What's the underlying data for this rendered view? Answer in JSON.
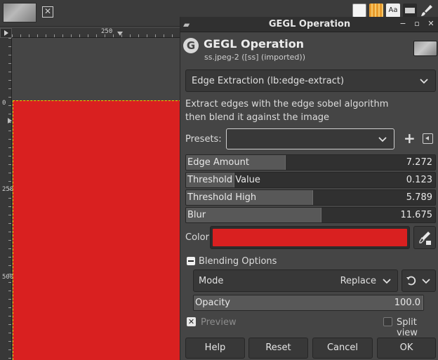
{
  "canvas": {
    "ruler_h_label": "250",
    "ruler_v_labels": [
      "0",
      "250",
      "500"
    ],
    "image_color": "#d92020",
    "selection_color": "#e6d400"
  },
  "toolbar": {
    "icons": [
      "new-layer-icon",
      "brushes-icon",
      "text-icon",
      "pattern-icon",
      "paintbrush-icon"
    ],
    "text_icon_label": "Aa"
  },
  "dialog": {
    "window_title": "GEGL Operation",
    "header_title": "GEGL Operation",
    "header_subtitle": "ss.jpeg-2 ([ss] (imported))",
    "operation": "Edge Extraction (lb:edge-extract)",
    "description_line1": "Extract edges with the edge sobel algorithm",
    "description_line2": "then blend it against the image",
    "presets_label": "Presets:",
    "presets_value": "",
    "sliders": [
      {
        "label": "Edge Amount",
        "value": "7.272",
        "fill": 0.4
      },
      {
        "label": "Threshold Value",
        "value": "0.123",
        "fill": 0.195
      },
      {
        "label": "Threshold High",
        "value": "5.789",
        "fill": 0.51
      },
      {
        "label": "Blur",
        "value": "11.675",
        "fill": 0.545
      }
    ],
    "color_label": "Color",
    "color_value": "#d92020",
    "blending_label": "Blending Options",
    "mode_label": "Mode",
    "mode_value": "Replace",
    "opacity_label": "Opacity",
    "opacity_value": "100.0",
    "opacity_fill": 1.0,
    "preview_label": "Preview",
    "split_view_label": "Split view",
    "buttons": {
      "help": "Help",
      "reset": "Reset",
      "cancel": "Cancel",
      "ok": "OK"
    }
  }
}
